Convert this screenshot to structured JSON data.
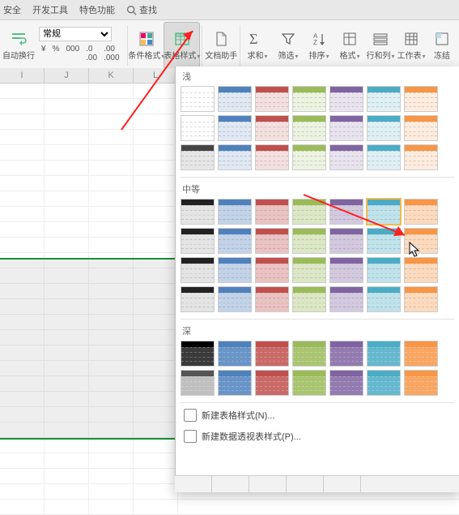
{
  "menu": {
    "items": [
      "安全",
      "开发工具",
      "特色功能"
    ],
    "search": "查找"
  },
  "ribbon": {
    "wrap": "自动换行",
    "numfmt_selected": "常规",
    "numfmt_buttons": [
      "¥",
      "%",
      "000",
      ".0 .00",
      ".00 .000"
    ],
    "condfmt": "条件格式",
    "tablestyle": "表格样式",
    "dochelper": "文档助手",
    "sum": "求和",
    "filter": "筛选",
    "sort": "排序",
    "format": "格式",
    "rowcol": "行和列",
    "worksheet": "工作表",
    "freeze": "冻结"
  },
  "columns": [
    "I",
    "J",
    "K",
    "L"
  ],
  "panel": {
    "sections": {
      "light": "浅",
      "medium": "中等",
      "dark": "深"
    },
    "footer": {
      "new_table": "新建表格样式(N)...",
      "new_pivot": "新建数据透视表样式(P)..."
    },
    "colors": {
      "none": "#ffffff",
      "blue": "#4f81bd",
      "red": "#c0504d",
      "olive": "#9bbb59",
      "purple": "#8064a2",
      "teal": "#4bacc6",
      "orange": "#f79646",
      "ltblue": "#7fb3e0",
      "black": "#2b2b2b",
      "gray": "#8a8a8a"
    },
    "light_rows": [
      [
        "none",
        "blue",
        "red",
        "olive",
        "purple",
        "teal",
        "orange"
      ],
      [
        "none",
        "blue",
        "red",
        "olive",
        "purple",
        "teal",
        "orange"
      ],
      [
        "gray",
        "blue",
        "red",
        "olive",
        "purple",
        "teal",
        "orange"
      ]
    ],
    "medium_rows": [
      [
        "black",
        "blue",
        "red",
        "olive",
        "purple",
        "teal",
        "orange"
      ],
      [
        "black",
        "blue",
        "red",
        "olive",
        "purple",
        "teal",
        "orange"
      ],
      [
        "black",
        "blue",
        "red",
        "olive",
        "purple",
        "teal",
        "orange"
      ],
      [
        "black",
        "blue",
        "red",
        "olive",
        "purple",
        "teal",
        "orange"
      ]
    ],
    "dark_rows": [
      [
        "black",
        "blue",
        "red",
        "olive",
        "purple",
        "teal",
        "orange"
      ],
      [
        "gray",
        "blue",
        "red",
        "olive",
        "purple",
        "teal",
        "orange"
      ]
    ],
    "hover_index": {
      "section": "medium",
      "row": 0,
      "col": 5
    }
  }
}
